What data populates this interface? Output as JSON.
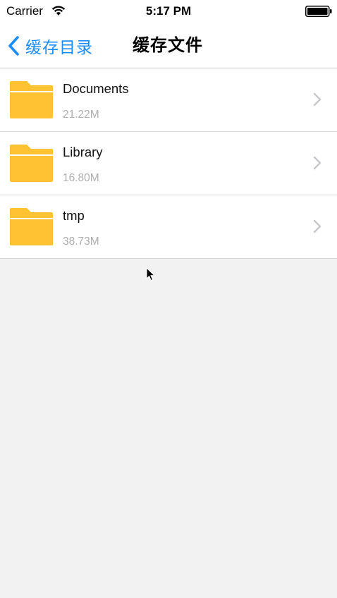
{
  "status_bar": {
    "carrier": "Carrier",
    "time": "5:17 PM",
    "icons": [
      "wifi-icon",
      "battery-icon"
    ]
  },
  "nav_bar": {
    "back_label": "缓存目录",
    "title": "缓存文件",
    "accent_color": "#1a8cff"
  },
  "files": [
    {
      "name": "Documents",
      "size": "21.22M",
      "icon": "folder-icon"
    },
    {
      "name": "Library",
      "size": "16.80M",
      "icon": "folder-icon"
    },
    {
      "name": "tmp",
      "size": "38.73M",
      "icon": "folder-icon"
    }
  ],
  "colors": {
    "folder": "#ffc233",
    "background": "#f2f2f2",
    "secondary_text": "#aeaeae"
  }
}
